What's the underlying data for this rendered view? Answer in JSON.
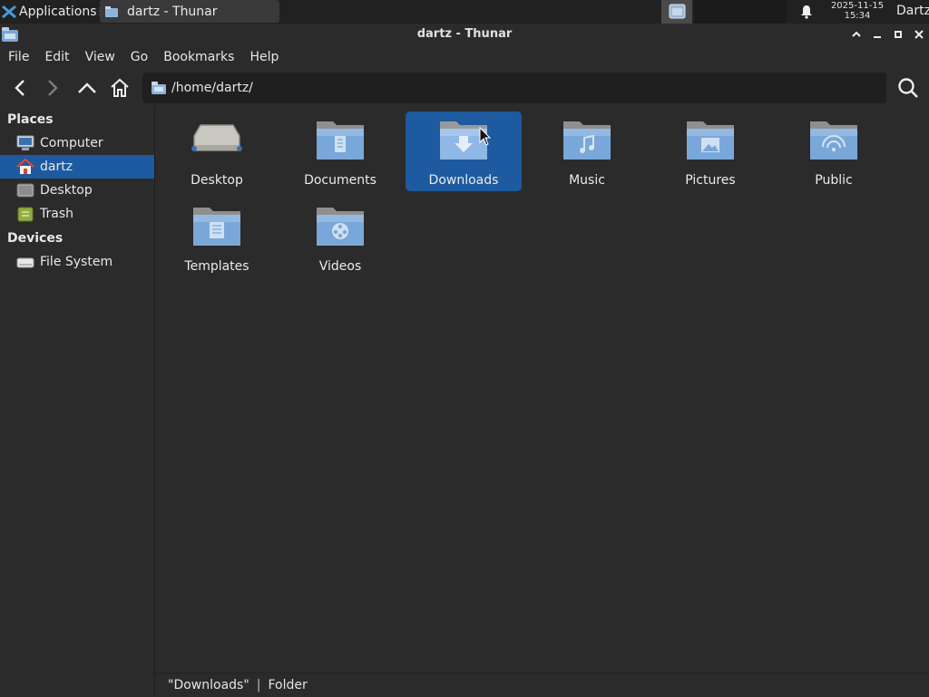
{
  "panel": {
    "applications_label": "Applications",
    "task_label": "dartz - Thunar",
    "clock_date": "2025-11-15",
    "clock_time": "15:34",
    "user": "Dartz"
  },
  "window": {
    "title": "dartz - Thunar"
  },
  "menu": [
    "File",
    "Edit",
    "View",
    "Go",
    "Bookmarks",
    "Help"
  ],
  "location": {
    "path": "/home/dartz/"
  },
  "sidebar": {
    "places_header": "Places",
    "places": [
      {
        "label": "Computer",
        "icon": "computer-icon"
      },
      {
        "label": "dartz",
        "icon": "home-icon",
        "selected": true
      },
      {
        "label": "Desktop",
        "icon": "desktop-icon"
      },
      {
        "label": "Trash",
        "icon": "trash-icon"
      }
    ],
    "devices_header": "Devices",
    "devices": [
      {
        "label": "File System",
        "icon": "drive-icon"
      }
    ]
  },
  "folders": [
    {
      "name": "Desktop",
      "emblem": "desktop"
    },
    {
      "name": "Documents",
      "emblem": "document"
    },
    {
      "name": "Downloads",
      "emblem": "download",
      "selected": true
    },
    {
      "name": "Music",
      "emblem": "music"
    },
    {
      "name": "Pictures",
      "emblem": "picture"
    },
    {
      "name": "Public",
      "emblem": "share"
    },
    {
      "name": "Templates",
      "emblem": "template"
    },
    {
      "name": "Videos",
      "emblem": "video"
    }
  ],
  "status": {
    "selection": "\"Downloads\"",
    "separator": "|",
    "type": "Folder"
  },
  "colors": {
    "selection": "#1d5a9f",
    "background": "#2b2b2b",
    "folder": "#7aa7d9"
  }
}
